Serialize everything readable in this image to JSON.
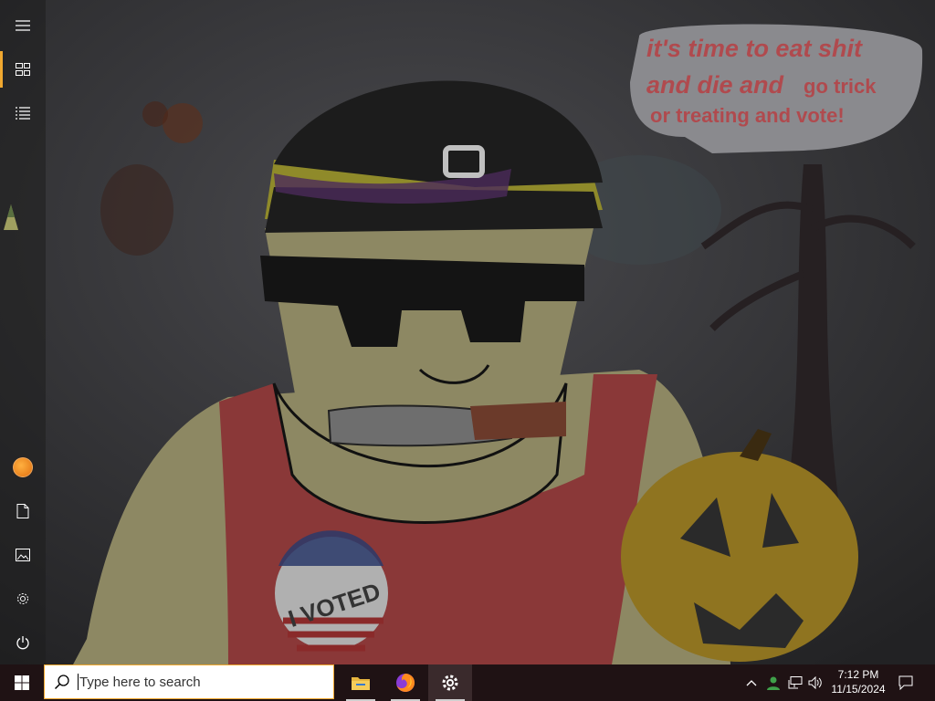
{
  "wallpaper": {
    "speech_bubble_line1": "it's time to eat shit",
    "speech_bubble_line2a": "and die and",
    "speech_bubble_line2b": "go trick",
    "speech_bubble_line3": "or treating and vote!",
    "badge_text": "I VOTED"
  },
  "start_rail": {
    "items": [
      {
        "name": "menu",
        "icon": "hamburger-icon"
      },
      {
        "name": "pinned",
        "icon": "tiles-icon"
      },
      {
        "name": "all-apps",
        "icon": "list-icon"
      },
      {
        "name": "user",
        "icon": "pumpkin-avatar"
      },
      {
        "name": "documents",
        "icon": "document-icon"
      },
      {
        "name": "pictures",
        "icon": "picture-icon"
      },
      {
        "name": "settings",
        "icon": "gear-icon"
      },
      {
        "name": "power",
        "icon": "power-icon"
      }
    ],
    "accent": "#f0a830"
  },
  "taskbar": {
    "search_placeholder": "Type here to search",
    "apps": [
      {
        "name": "File Explorer",
        "icon": "folder-icon"
      },
      {
        "name": "Firefox",
        "icon": "firefox-icon"
      },
      {
        "name": "Settings",
        "icon": "gear-icon"
      }
    ],
    "tray_icons": [
      "chevron-up-icon",
      "people-icon",
      "network-icon",
      "volume-icon"
    ],
    "time": "7:12 PM",
    "date": "11/15/2024"
  }
}
